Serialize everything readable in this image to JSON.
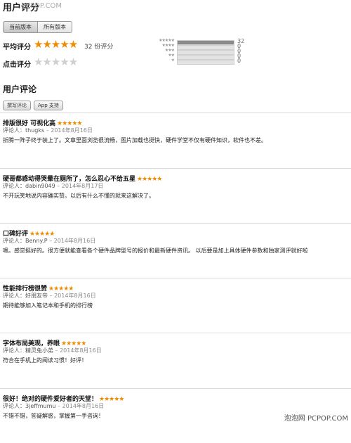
{
  "header": {
    "title": "用户评分",
    "watermark": "PCPOP.COM"
  },
  "segmented": {
    "current": "当前版本",
    "all": "所有版本"
  },
  "rating": {
    "avg_label": "平均评分",
    "avg_stars": "★★★★★",
    "count_text": "32 份评分",
    "tap_label": "点击评分",
    "tap_stars": "★★★★★",
    "histogram": [
      {
        "stars": "★★★★★",
        "count": "32",
        "fraction": 1.0
      },
      {
        "stars": "★★★★",
        "count": "0",
        "fraction": 0
      },
      {
        "stars": "★★★",
        "count": "0",
        "fraction": 0
      },
      {
        "stars": "★★",
        "count": "0",
        "fraction": 0
      },
      {
        "stars": "★",
        "count": "0",
        "fraction": 0
      }
    ]
  },
  "reviews_section": {
    "title": "用户评论",
    "write_button": "撰写评论",
    "support_button": "App 支持"
  },
  "reviews": [
    {
      "title": "排版很好 可视化高",
      "stars": "★★★★★",
      "author_label": "评论人：",
      "author": "thugks",
      "date": "– 2014年8月16日",
      "body": "折腾一阵子终于装上了。文章里面浏览很流畅，图片加载也挺快，硬件学堂不仅有硬件知识，软件也不差。"
    },
    {
      "title": "硬哥都感动得哭晕在厕所了，怎么忍心不给五星",
      "stars": "★★★★★",
      "author_label": "评论人：",
      "author": "dabin9049",
      "date": "– 2014年8月17日",
      "body": "不开玩笑地说内容确实赞。以后有什么不懂的就来这解决了。"
    },
    {
      "title": "口碑好评",
      "stars": "★★★★★",
      "author_label": "评论人：",
      "author": "Benny.P",
      "date": "– 2014年8月16日",
      "body": "嗯。感觉挺好的。很方便就能查看各个硬件品牌型号的报价和最新硬件资讯。 以后要是加上具体硬件参数和独家测评就好啦"
    },
    {
      "title": "性能排行榜很赞",
      "stars": "★★★★★",
      "author_label": "评论人：",
      "author": "好朋友帝",
      "date": "– 2014年8月16日",
      "body": "期待能够加入笔记本和手机的排行榜"
    },
    {
      "title": "字体布局美观，养眼",
      "stars": "★★★★★",
      "author_label": "评论人：",
      "author": "精灵兔小弟",
      "date": "– 2014年8月16日",
      "body": "符合在手机上的阅读习惯！好评！"
    },
    {
      "title": "很好！绝对的硬件爱好者的天堂！",
      "stars": "★★★★★",
      "author_label": "评论人：",
      "author": "3jeffmumu",
      "date": "– 2014年8月16日",
      "body": "不错不错，答疑解惑，掌握第一手咨询！"
    }
  ],
  "footer": {
    "watermark": "泡泡网 PCPOP.COM"
  },
  "colors": {
    "star": "#f08a00",
    "star_off": "#cfcfcf",
    "bar_fill": "#8a8a8a"
  }
}
